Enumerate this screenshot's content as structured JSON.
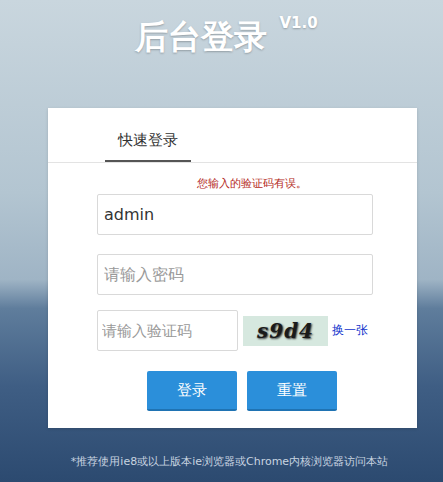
{
  "page": {
    "title": "后台登录",
    "version": "V1.0"
  },
  "tabs": [
    {
      "label": "快速登录",
      "selected": true
    }
  ],
  "error": "您输入的验证码有误。",
  "fields": [
    {
      "name": "username",
      "value": "admin",
      "placeholder": ""
    },
    {
      "name": "password",
      "value": "",
      "placeholder": "请输入密码"
    }
  ],
  "captcha": {
    "placeholder": "请输入验证码",
    "code": "s9d4",
    "refresh": "换一张"
  },
  "buttons": [
    "登录",
    "重置"
  ],
  "footer": "*推荐使用ie8或以上版本ie浏览器或Chrome内核浏览器访问本站"
}
